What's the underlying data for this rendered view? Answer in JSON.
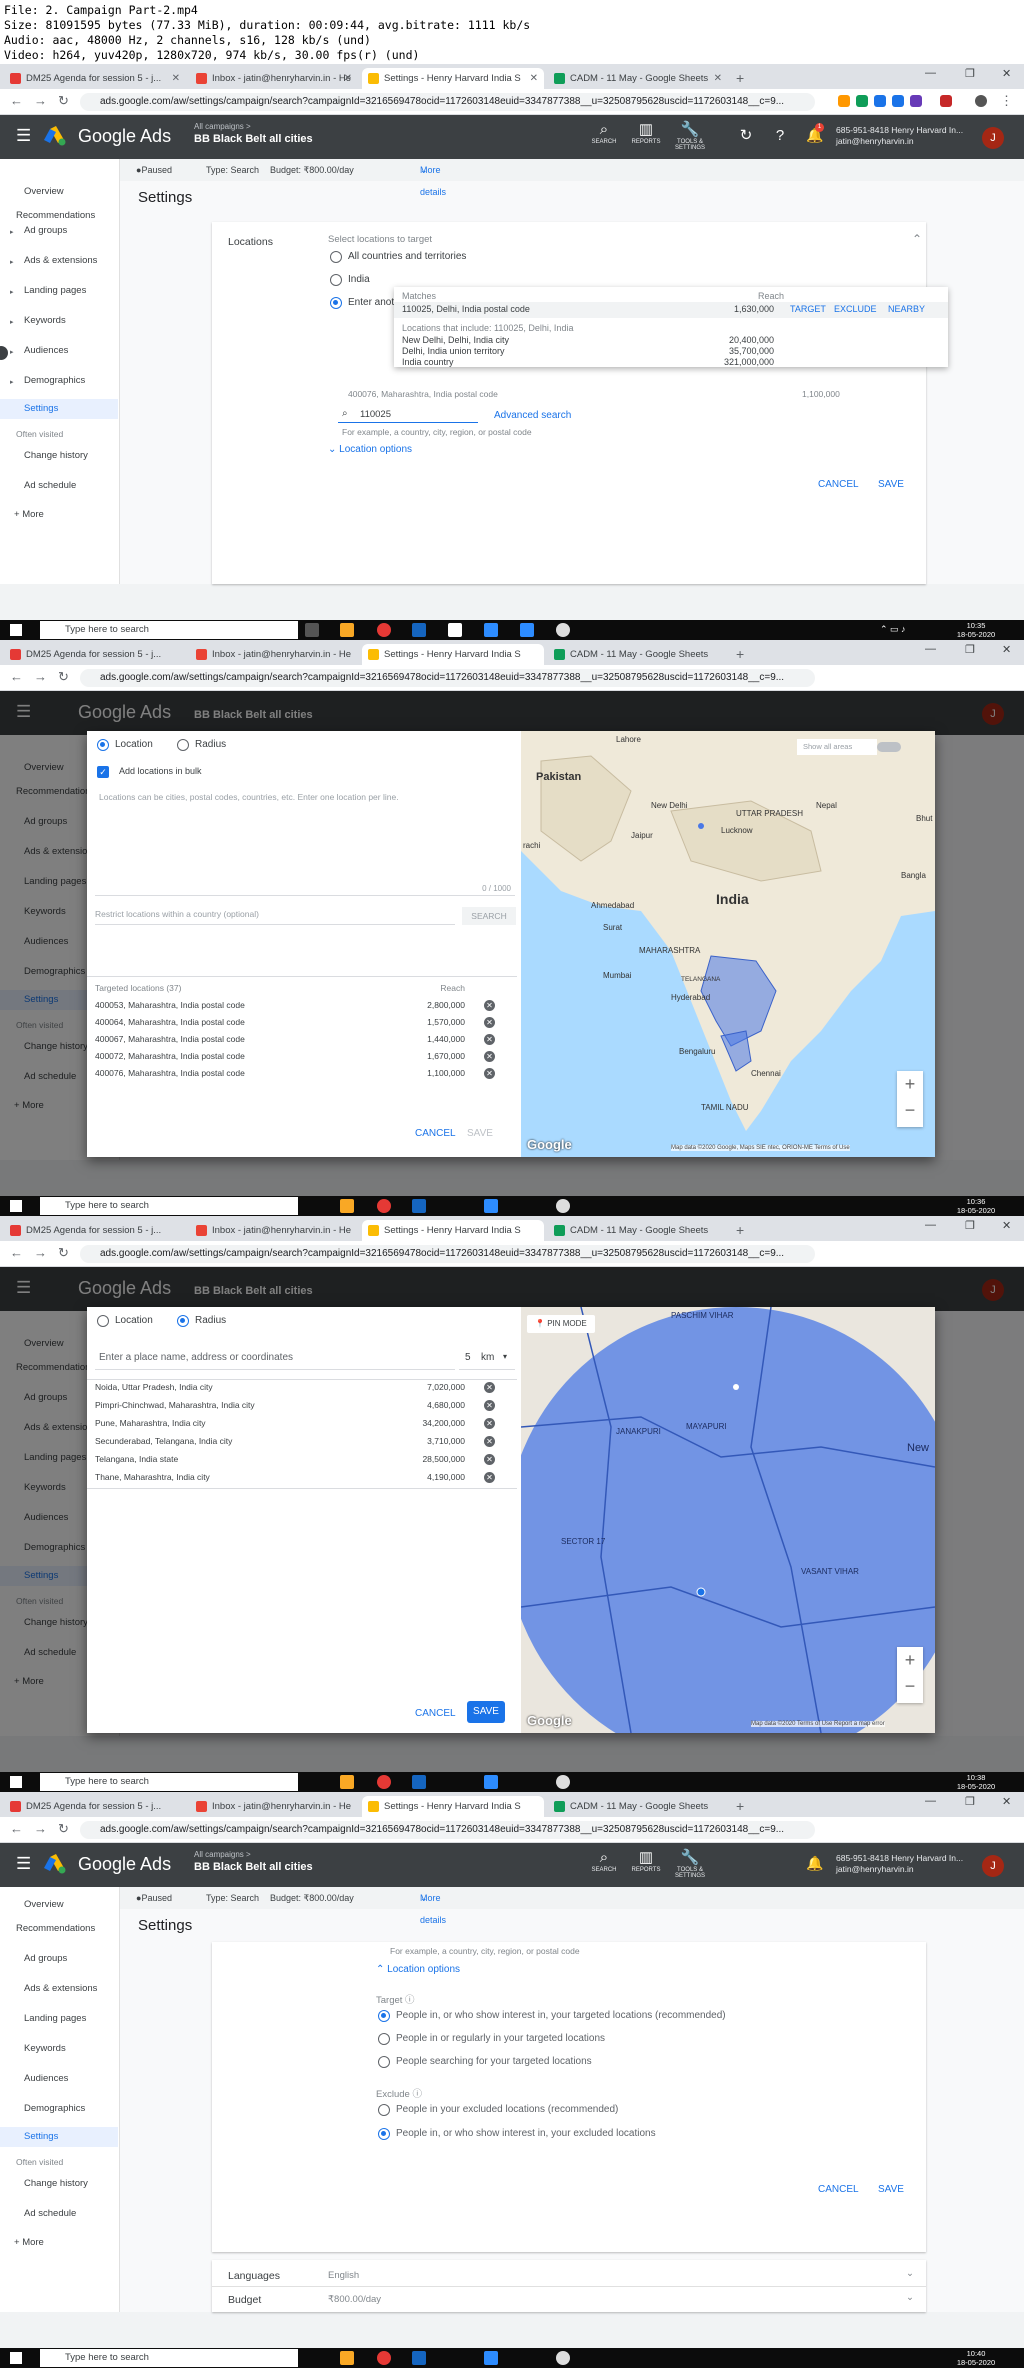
{
  "file_info": {
    "line1": "File: 2. Campaign Part-2.mp4",
    "line2": "Size: 81091595 bytes (77.33 MiB), duration: 00:09:44, avg.bitrate: 1111 kb/s",
    "line3": "Audio: aac, 48000 Hz, 2 channels, s16, 128 kb/s (und)",
    "line4": "Video: h264, yuv420p, 1280x720, 974 kb/s, 30.00 fps(r) (und)"
  },
  "browser": {
    "tabs": [
      {
        "title": "DM25 Agenda for session 5 - j...",
        "color": "#e53935"
      },
      {
        "title": "Inbox - jatin@henryharvin.in - He",
        "color": "#ea4335"
      },
      {
        "title": "Settings - Henry Harvard India S",
        "color": "#fbbc04"
      },
      {
        "title": "CADM - 11 May - Google Sheets",
        "color": "#0f9d58"
      }
    ],
    "url": "ads.google.com/aw/settings/campaign/search?campaignId=3216569478ocid=1172603148euid=3347877388__u=32508795628uscid=1172603148__c=9..."
  },
  "ads_header": {
    "brand": "Google Ads",
    "breadcrumb": "All campaigns  >",
    "campaign": "BB Black Belt all cities",
    "tools": [
      "SEARCH",
      "REPORTS",
      "TOOLS & SETTINGS"
    ],
    "phone": "685-951-8418 Henry Harvard In...",
    "email": "jatin@henryharvin.in",
    "avatar": "J",
    "badge": "1"
  },
  "sidebar": {
    "items": [
      "Overview",
      "Recommendations",
      "Ad groups",
      "Ads & extensions",
      "Landing pages",
      "Keywords",
      "Audiences",
      "Demographics",
      "Settings"
    ],
    "often_visited": "Often visited",
    "lower": [
      "Change history",
      "Ad schedule"
    ],
    "more": "More"
  },
  "infobar": {
    "status": "Paused",
    "type": "Type: Search",
    "budget": "Budget: ₹800.00/day",
    "more": "More details"
  },
  "page_title": "Settings",
  "frame1": {
    "section": "Locations",
    "select_label": "Select locations to target",
    "options": [
      "All countries and territories",
      "India",
      "Enter another location"
    ],
    "drop_matches": "Matches",
    "drop_reach": "Reach",
    "match_row": "110025, Delhi, India postal code",
    "match_reach": "1,630,000",
    "actions": [
      "TARGET",
      "EXCLUDE",
      "NEARBY"
    ],
    "include_header": "Locations that include: 110025, Delhi, India",
    "include_rows": [
      {
        "name": "New Delhi, Delhi, India city",
        "reach": "20,400,000"
      },
      {
        "name": "Delhi, India union territory",
        "reach": "35,700,000"
      },
      {
        "name": "India country",
        "reach": "321,000,000"
      }
    ],
    "behind_row": "400076, Maharashtra, India postal code",
    "behind_reach": "1,100,000",
    "search_value": "110025",
    "advanced": "Advanced search",
    "hint": "For example, a country, city, region, or postal code",
    "loc_options": "Location options",
    "cancel": "CANCEL",
    "save": "SAVE",
    "time": "10:35",
    "date": "18-05-2020"
  },
  "frame2": {
    "tab_location": "Location",
    "tab_radius": "Radius",
    "bulk": "Add locations in bulk",
    "placeholder": "Locations can be cities, postal codes, countries, etc. Enter one location per line.",
    "counter": "0 / 1000",
    "restrict": "Restrict locations within a country (optional)",
    "search_btn": "SEARCH",
    "targeted_header": "Targeted locations (37)",
    "reach_header": "Reach",
    "rows": [
      {
        "name": "400053, Maharashtra, India postal code",
        "reach": "2,800,000"
      },
      {
        "name": "400064, Maharashtra, India postal code",
        "reach": "1,570,000"
      },
      {
        "name": "400067, Maharashtra, India postal code",
        "reach": "1,440,000"
      },
      {
        "name": "400072, Maharashtra, India postal code",
        "reach": "1,670,000"
      },
      {
        "name": "400076, Maharashtra, India postal code",
        "reach": "1,100,000"
      }
    ],
    "show_areas": "Show all areas",
    "cancel": "CANCEL",
    "save": "SAVE",
    "map_labels": [
      "Lahore",
      "Pakistan",
      "New Delhi",
      "UTTAR PRADESH",
      "Lucknow",
      "Nepal",
      "Bhut",
      "Bangla",
      "Ahmedabad",
      "India",
      "Surat",
      "MAHARASHTRA",
      "Mumbai",
      "Hyderabad",
      "TELANGANA",
      "Bengaluru",
      "Chennai",
      "TAMIL NADU",
      "rachi",
      "Jaipur"
    ],
    "map_credit": "Map data ©2020 Google, Maps SIE ntec, ORION-ME  Terms of Use",
    "time": "10:36",
    "date": "18-05-2020"
  },
  "frame3": {
    "tab_location": "Location",
    "tab_radius": "Radius",
    "placeholder": "Enter a place name, address or coordinates",
    "radius_value": "5",
    "radius_unit": "km",
    "rows": [
      {
        "name": "Noida, Uttar Pradesh, India city",
        "reach": "7,020,000"
      },
      {
        "name": "Pimpri-Chinchwad, Maharashtra, India city",
        "reach": "4,680,000"
      },
      {
        "name": "Pune, Maharashtra, India city",
        "reach": "34,200,000"
      },
      {
        "name": "Secunderabad, Telangana, India city",
        "reach": "3,710,000"
      },
      {
        "name": "Telangana, India state",
        "reach": "28,500,000"
      },
      {
        "name": "Thane, Maharashtra, India city",
        "reach": "4,190,000"
      }
    ],
    "pin_mode": "PIN MODE",
    "cancel": "CANCEL",
    "save": "SAVE",
    "map_labels": [
      "PASCHIM VIHAR",
      "JANAKPURI",
      "MAYAPURI",
      "SECTOR 17",
      "VASANT VIHAR",
      "New"
    ],
    "map_credit": "Map data ©2020  Terms of Use  Report a map error",
    "time": "10:38",
    "date": "18-05-2020"
  },
  "frame4": {
    "hint": "For example, a country, city, region, or postal code",
    "loc_options": "Location options",
    "target_label": "Target",
    "target_options": [
      "People in, or who show interest in, your targeted locations (recommended)",
      "People in or regularly in your targeted locations",
      "People searching for your targeted locations"
    ],
    "exclude_label": "Exclude",
    "exclude_options": [
      "People in your excluded locations (recommended)",
      "People in, or who show interest in, your excluded locations"
    ],
    "cancel": "CANCEL",
    "save": "SAVE",
    "languages_label": "Languages",
    "languages_value": "English",
    "budget_label": "Budget",
    "budget_value": "₹800.00/day",
    "time": "10:40",
    "date": "18-05-2020"
  },
  "taskbar": {
    "search": "Type here to search"
  },
  "colors": {
    "accent": "#1a73e8",
    "header": "#3c4043",
    "map_fill": "#4a78e6"
  }
}
